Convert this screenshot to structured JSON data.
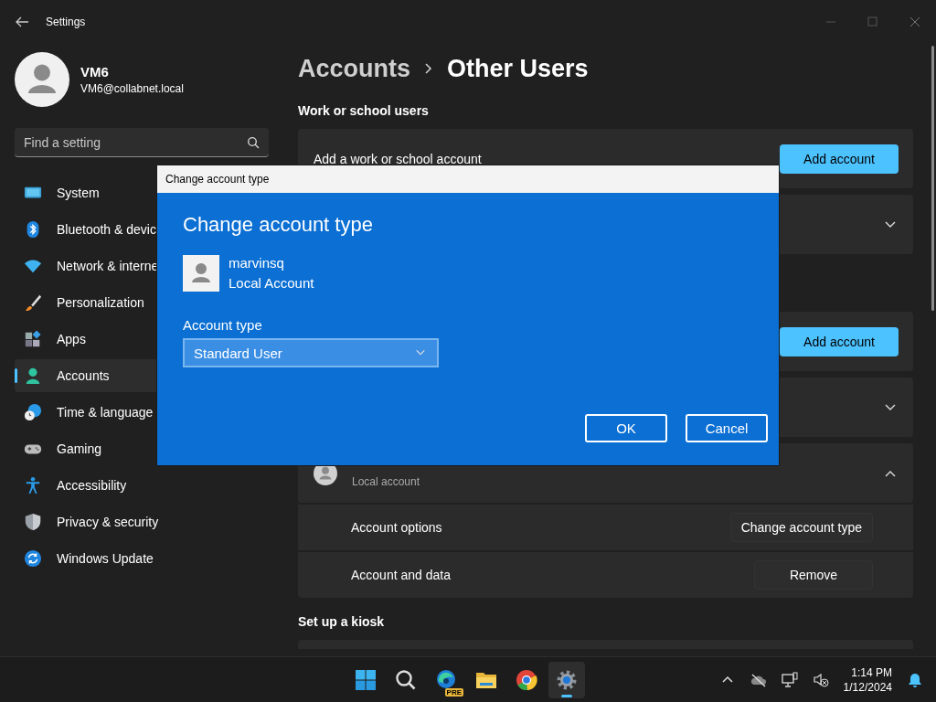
{
  "window": {
    "title": "Settings"
  },
  "profile": {
    "name": "VM6",
    "email": "VM6@collabnet.local"
  },
  "search": {
    "placeholder": "Find a setting"
  },
  "nav": [
    {
      "label": "System",
      "selected": false
    },
    {
      "label": "Bluetooth & devic",
      "selected": false
    },
    {
      "label": "Network & interne",
      "selected": false
    },
    {
      "label": "Personalization",
      "selected": false
    },
    {
      "label": "Apps",
      "selected": false
    },
    {
      "label": "Accounts",
      "selected": true
    },
    {
      "label": "Time & language",
      "selected": false
    },
    {
      "label": "Gaming",
      "selected": false
    },
    {
      "label": "Accessibility",
      "selected": false
    },
    {
      "label": "Privacy & security",
      "selected": false
    },
    {
      "label": "Windows Update",
      "selected": false
    }
  ],
  "breadcrumb": [
    "Accounts",
    "Other Users"
  ],
  "sections": [
    {
      "heading": "Work or school users",
      "cards": [
        {
          "kind": "action",
          "label": "Add a work or school account",
          "button": "Add account"
        },
        {
          "kind": "collapsed"
        }
      ]
    },
    {
      "cards": [
        {
          "kind": "action",
          "button": "Add account"
        },
        {
          "kind": "collapsed"
        },
        {
          "kind": "user",
          "subtitle": "Local account",
          "expanded": true,
          "rows": [
            {
              "label": "Account options",
              "button": "Change account type"
            },
            {
              "label": "Account and data",
              "button": "Remove"
            }
          ]
        }
      ]
    },
    {
      "heading": "Set up a kiosk",
      "cards": [
        {
          "kind": "stub"
        }
      ]
    }
  ],
  "dialog": {
    "caption": "Change account type",
    "title": "Change account type",
    "user": {
      "name": "marvinsq",
      "type": "Local Account"
    },
    "field_label": "Account type",
    "select": {
      "value": "Standard User"
    },
    "buttons": [
      "OK",
      "Cancel"
    ]
  },
  "taskbar": {
    "apps": [
      {
        "selected": false
      },
      {
        "selected": false
      },
      {
        "selected": false,
        "badge": "PRE"
      },
      {
        "selected": false
      },
      {
        "selected": false
      },
      {
        "selected": true
      }
    ],
    "clock": {
      "time": "1:14 PM",
      "date": "1/12/2024"
    }
  }
}
